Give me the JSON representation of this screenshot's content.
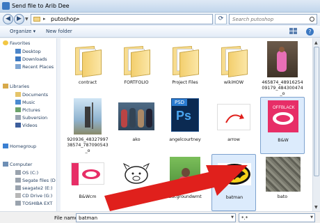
{
  "window": {
    "title": "Send file to Arib Dee"
  },
  "address": {
    "current_folder": "putoshop",
    "search_placeholder": "Search putoshop"
  },
  "toolbar": {
    "organize_label": "Organize ▾",
    "new_folder_label": "New folder"
  },
  "sidebar": {
    "items": [
      {
        "label": "Favorites",
        "level": "header",
        "icon": "star-icon"
      },
      {
        "label": "Desktop",
        "level": "sub",
        "icon": "desktop-icon"
      },
      {
        "label": "Downloads",
        "level": "sub",
        "icon": "downloads-icon"
      },
      {
        "label": "Recent Places",
        "level": "sub",
        "icon": "recent-places-icon"
      },
      {
        "label": "Libraries",
        "level": "header",
        "icon": "libraries-icon"
      },
      {
        "label": "Documents",
        "level": "sub",
        "icon": "documents-icon"
      },
      {
        "label": "Music",
        "level": "sub",
        "icon": "music-icon"
      },
      {
        "label": "Pictures",
        "level": "sub",
        "icon": "pictures-icon"
      },
      {
        "label": "Subversion",
        "level": "sub",
        "icon": "subversion-icon"
      },
      {
        "label": "Videos",
        "level": "sub",
        "icon": "videos-icon"
      },
      {
        "label": "Homegroup",
        "level": "header",
        "icon": "homegroup-icon"
      },
      {
        "label": "Computer",
        "level": "header",
        "icon": "computer-icon"
      },
      {
        "label": "OS (C:)",
        "level": "sub",
        "icon": "drive-icon"
      },
      {
        "label": "Segate files (D",
        "level": "sub",
        "icon": "drive-icon"
      },
      {
        "label": "seagate2 (E:)",
        "level": "sub",
        "icon": "drive-icon"
      },
      {
        "label": "CD Drive (G:)",
        "level": "sub",
        "icon": "cd-drive-icon"
      },
      {
        "label": "TOSHIBA EXT",
        "level": "sub",
        "icon": "drive-icon"
      }
    ]
  },
  "files": [
    {
      "name": "contract",
      "kind": "folder"
    },
    {
      "name": "FORTFOLIO",
      "kind": "folder"
    },
    {
      "name": "Project Files",
      "kind": "folder"
    },
    {
      "name": "wikiHOW",
      "kind": "folder"
    },
    {
      "name": "465874_48916254 09179_484300474 _o",
      "kind": "photo-girl"
    },
    {
      "name": "920936_48327997 38574_787090543 _o",
      "kind": "photo-man"
    },
    {
      "name": "ako",
      "kind": "photo-group"
    },
    {
      "name": "angelcourtney",
      "kind": "psd",
      "badge": "PSD",
      "glyph": "Ps"
    },
    {
      "name": "arrow",
      "kind": "arrow"
    },
    {
      "name": "B&W",
      "kind": "bw",
      "selected": true
    },
    {
      "name": "B&Wcm",
      "kind": "bwcm"
    },
    {
      "name": "BABOY",
      "kind": "pig"
    },
    {
      "name": "bacgroundwmt",
      "kind": "photo-bg"
    },
    {
      "name": "batman",
      "kind": "batman",
      "selected": true
    },
    {
      "name": "bato",
      "kind": "rock"
    }
  ],
  "footer": {
    "filename_label": "File name:",
    "filename_value": "batman",
    "filter_value": "*.*"
  },
  "colors": {
    "selection": "#dcebfc",
    "annotation_arrow": "#e0201c",
    "titlebar": "#c2d6ec"
  }
}
